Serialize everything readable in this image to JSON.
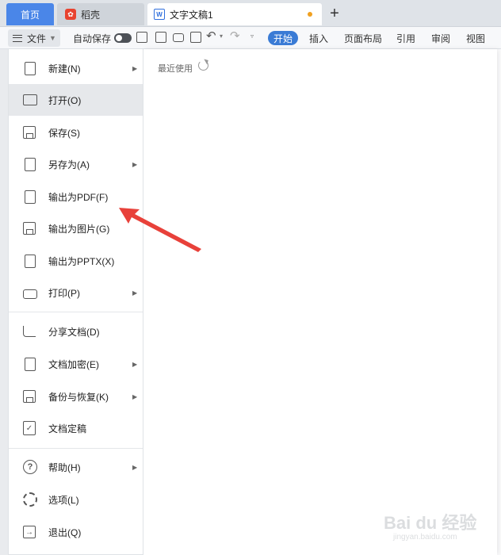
{
  "tabs": {
    "home": "首页",
    "daoke": "稻壳",
    "document": "文字文稿1",
    "add": "+"
  },
  "ribbon": {
    "file": "文件",
    "autosave": "自动保存",
    "tabs": [
      "开始",
      "插入",
      "页面布局",
      "引用",
      "审阅",
      "视图"
    ]
  },
  "recent": {
    "title": "最近使用"
  },
  "menu": {
    "items": [
      {
        "label": "新建(N)",
        "icon": "new-doc-icon",
        "has_submenu": true
      },
      {
        "label": "打开(O)",
        "icon": "folder-open-icon",
        "has_submenu": false
      },
      {
        "label": "保存(S)",
        "icon": "save-icon",
        "has_submenu": false
      },
      {
        "label": "另存为(A)",
        "icon": "save-as-icon",
        "has_submenu": true
      },
      {
        "label": "输出为PDF(F)",
        "icon": "export-pdf-icon",
        "has_submenu": false
      },
      {
        "label": "输出为图片(G)",
        "icon": "export-image-icon",
        "has_submenu": false
      },
      {
        "label": "输出为PPTX(X)",
        "icon": "export-pptx-icon",
        "has_submenu": false
      },
      {
        "label": "打印(P)",
        "icon": "printer-icon",
        "has_submenu": true
      },
      {
        "label": "分享文档(D)",
        "icon": "share-icon",
        "has_submenu": false
      },
      {
        "label": "文档加密(E)",
        "icon": "encrypt-icon",
        "has_submenu": true
      },
      {
        "label": "备份与恢复(K)",
        "icon": "backup-icon",
        "has_submenu": true
      },
      {
        "label": "文档定稿",
        "icon": "finalize-icon",
        "has_submenu": false
      },
      {
        "label": "帮助(H)",
        "icon": "help-icon",
        "has_submenu": true
      },
      {
        "label": "选项(L)",
        "icon": "gear-icon",
        "has_submenu": false
      },
      {
        "label": "退出(Q)",
        "icon": "exit-icon",
        "has_submenu": false
      }
    ],
    "active_item": "打开(O)"
  },
  "watermark": {
    "text": "Bai du 经验",
    "sub": "jingyan.baidu.com"
  },
  "colors": {
    "accent": "#3a7bd5",
    "home_tab": "#4a86e8",
    "arrow": "#e8413a",
    "modified_dot": "#f0a020"
  }
}
